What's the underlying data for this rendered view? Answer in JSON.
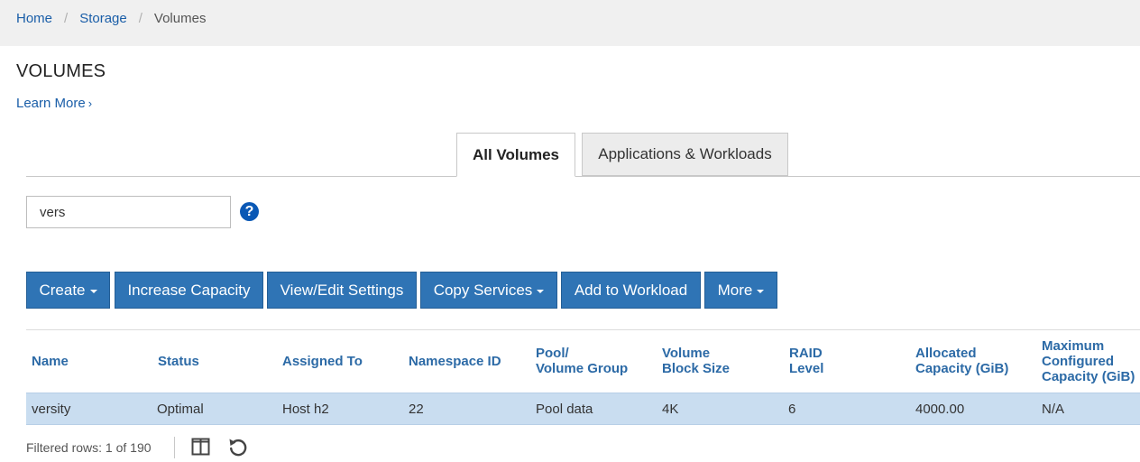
{
  "breadcrumb": {
    "home": "Home",
    "storage": "Storage",
    "current": "Volumes",
    "separator": "/"
  },
  "page": {
    "title": "VOLUMES",
    "learn_more": "Learn More",
    "learn_more_chevron": "›"
  },
  "tabs": [
    {
      "label": "All Volumes",
      "active": true
    },
    {
      "label": "Applications & Workloads",
      "active": false
    }
  ],
  "search": {
    "value": "vers",
    "help_symbol": "?"
  },
  "toolbar": {
    "create": "Create",
    "increase_capacity": "Increase Capacity",
    "view_edit_settings": "View/Edit Settings",
    "copy_services": "Copy Services",
    "add_to_workload": "Add to Workload",
    "more": "More"
  },
  "table": {
    "headers": {
      "name": "Name",
      "status": "Status",
      "assigned_to": "Assigned To",
      "namespace_id": "Namespace ID",
      "pool_line1": "Pool/",
      "pool_line2": "Volume Group",
      "block_line1": "Volume",
      "block_line2": "Block Size",
      "raid_line1": "RAID",
      "raid_line2": "Level",
      "alloc_line1": "Allocated",
      "alloc_line2": "Capacity (GiB)",
      "max_line1": "Maximum",
      "max_line2": "Configured",
      "max_line3": "Capacity (GiB)"
    },
    "rows": [
      {
        "name": "versity",
        "status": "Optimal",
        "assigned_to": "Host h2",
        "namespace_id": "22",
        "pool": "Pool data",
        "block_size": "4K",
        "raid_level": "6",
        "allocated": "4000.00",
        "max_configured": "N/A"
      }
    ]
  },
  "footer": {
    "filtered_rows": "Filtered rows: 1 of 190"
  },
  "colors": {
    "link": "#1a5ea8",
    "button": "#2f74b5",
    "selected_row": "#c9ddf0",
    "header_text": "#2c6aa6"
  }
}
